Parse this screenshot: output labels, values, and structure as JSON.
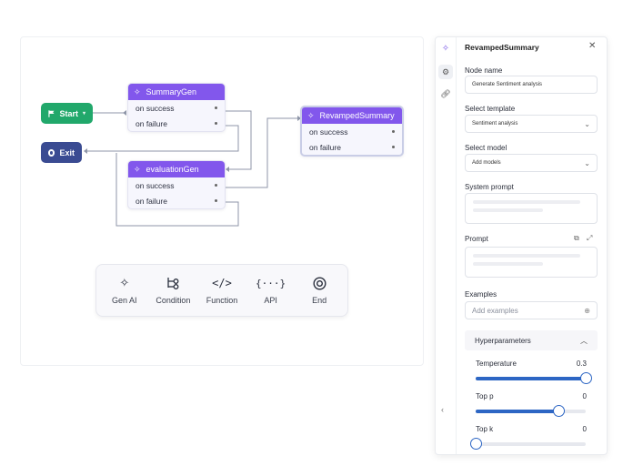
{
  "flow": {
    "start_label": "Start",
    "exit_label": "Exit",
    "nodes": [
      {
        "title": "SummaryGen",
        "rows": [
          "on success",
          "on failure"
        ]
      },
      {
        "title": "evaluationGen",
        "rows": [
          "on success",
          "on failure"
        ]
      },
      {
        "title": "RevampedSummary",
        "rows": [
          "on success",
          "on failure"
        ]
      }
    ],
    "colors": {
      "start": "#21a86b",
      "exit": "#3a4b92",
      "node_header": "#8257ec",
      "edge": "#8f96a8"
    }
  },
  "toolbar": {
    "items": [
      {
        "label": "Gen AI",
        "icon": "sparkle-icon"
      },
      {
        "label": "Condition",
        "icon": "branch-icon"
      },
      {
        "label": "Function",
        "icon": "code-icon"
      },
      {
        "label": "API",
        "icon": "api-braces-icon"
      },
      {
        "label": "End",
        "icon": "stop-circle-icon"
      }
    ]
  },
  "panel": {
    "title": "RevampedSummary",
    "node_name_label": "Node name",
    "node_name_value": "Generate Sentiment analysis",
    "template_label": "Select template",
    "template_value": "Sentiment analysis",
    "model_label": "Select model",
    "model_value": "Add models",
    "system_prompt_label": "System prompt",
    "prompt_label": "Prompt",
    "examples_label": "Examples",
    "examples_placeholder": "Add examples",
    "hyper_label": "Hyperparameters",
    "sliders": [
      {
        "label": "Temperature",
        "value_text": "0.3",
        "fraction": 1.0
      },
      {
        "label": "Top p",
        "value_text": "0",
        "fraction": 0.75
      },
      {
        "label": "Top k",
        "value_text": "0",
        "fraction": 0.0
      }
    ]
  }
}
